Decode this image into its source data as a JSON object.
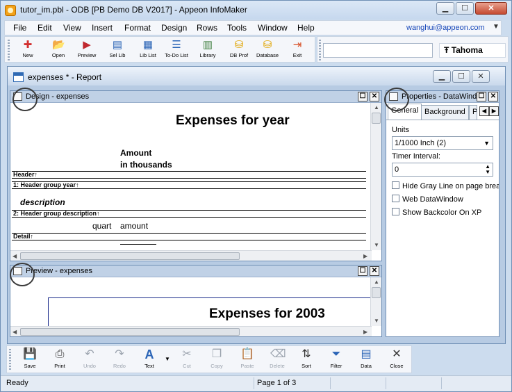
{
  "window": {
    "title": "tutor_im.pbl - ODB [PB Demo DB V2017]  - Appeon InfoMaker",
    "minimize": "▁",
    "maximize": "☐",
    "close": "✕"
  },
  "menu": {
    "items": [
      "File",
      "Edit",
      "View",
      "Insert",
      "Format",
      "Design",
      "Rows",
      "Tools",
      "Window",
      "Help"
    ],
    "user": "wanghui@appeon.com"
  },
  "toolbar": {
    "buttons": [
      {
        "label": "New",
        "icon": "new-icon",
        "glyph": "✚",
        "color": "#d23030"
      },
      {
        "label": "Open",
        "icon": "open-folder-icon",
        "glyph": "📂",
        "color": "#e0a400"
      },
      {
        "label": "Preview",
        "icon": "preview-icon",
        "glyph": "▶",
        "color": "#c0282f"
      },
      {
        "label": "Sel Lib",
        "icon": "select-library-icon",
        "glyph": "▤",
        "color": "#2a64b6"
      },
      {
        "label": "Lib List",
        "icon": "library-list-icon",
        "glyph": "▦",
        "color": "#2a64b6"
      },
      {
        "label": "To-Do List",
        "icon": "todo-list-icon",
        "glyph": "☰",
        "color": "#2a64b6"
      },
      {
        "label": "Library",
        "icon": "library-icon",
        "glyph": "▥",
        "color": "#3f7f3f"
      },
      {
        "label": "DB Prof",
        "icon": "db-profile-icon",
        "glyph": "⛁",
        "color": "#e0a400"
      },
      {
        "label": "Database",
        "icon": "database-icon",
        "glyph": "⛁",
        "color": "#e0a400"
      },
      {
        "label": "Exit",
        "icon": "exit-icon",
        "glyph": "⇥",
        "color": "#d64a20"
      }
    ],
    "font_name": "Tahoma"
  },
  "child_window": {
    "title": "expenses * - Report"
  },
  "design_pane": {
    "title": "Design - expenses",
    "report_title": "Expenses for  year",
    "amount_label": "Amount",
    "thousands_label": "in thousands",
    "bands": [
      "Header↑",
      "1: Header group year↑",
      "2: Header group description↑",
      "Detail↑"
    ],
    "description_field": "description",
    "quart_field": "quart",
    "amount_field": "amount"
  },
  "preview_pane": {
    "title": "Preview - expenses",
    "report_title": "Expenses for  2003"
  },
  "properties_pane": {
    "title": "Properties - DataWindow",
    "tabs": [
      "General",
      "Background",
      "P"
    ],
    "units_label": "Units",
    "units_value": "1/1000 Inch (2)",
    "timer_label": "Timer Interval:",
    "timer_value": "0",
    "checkboxes": [
      "Hide Gray Line on page break",
      "Web DataWindow",
      "Show Backcolor On XP"
    ]
  },
  "bottom_toolbar": {
    "buttons": [
      {
        "label": "Save",
        "icon": "save-icon",
        "glyph": "💾",
        "enabled": true
      },
      {
        "label": "Print",
        "icon": "print-icon",
        "glyph": "⎙",
        "enabled": true
      },
      {
        "label": "Undo",
        "icon": "undo-icon",
        "glyph": "↶",
        "enabled": false
      },
      {
        "label": "Redo",
        "icon": "redo-icon",
        "glyph": "↷",
        "enabled": false
      },
      {
        "label": "Text",
        "icon": "text-icon",
        "glyph": "A",
        "enabled": true
      },
      {
        "label": "Cut",
        "icon": "cut-icon",
        "glyph": "✂",
        "enabled": false
      },
      {
        "label": "Copy",
        "icon": "copy-icon",
        "glyph": "❐",
        "enabled": false
      },
      {
        "label": "Paste",
        "icon": "paste-icon",
        "glyph": "📋",
        "enabled": false
      },
      {
        "label": "Delete",
        "icon": "delete-icon",
        "glyph": "⌫",
        "enabled": false
      },
      {
        "label": "Sort",
        "icon": "sort-icon",
        "glyph": "⇅",
        "enabled": true
      },
      {
        "label": "Filter",
        "icon": "filter-icon",
        "glyph": "⏷",
        "enabled": true
      },
      {
        "label": "Data",
        "icon": "data-icon",
        "glyph": "▤",
        "enabled": true
      },
      {
        "label": "Close",
        "icon": "close-icon",
        "glyph": "✕",
        "enabled": true
      }
    ]
  },
  "status": {
    "text": "Ready",
    "page": "Page 1 of 3"
  },
  "colors": {
    "accent": "#2a64b6",
    "chrome": "#ccdcee"
  }
}
